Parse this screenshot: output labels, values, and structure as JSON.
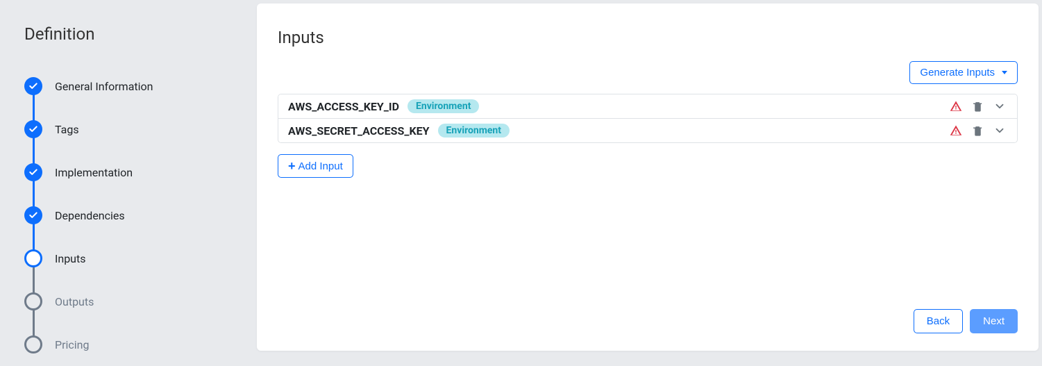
{
  "sidebar": {
    "title": "Definition",
    "steps": [
      {
        "label": "General Information",
        "state": "done"
      },
      {
        "label": "Tags",
        "state": "done"
      },
      {
        "label": "Implementation",
        "state": "done"
      },
      {
        "label": "Dependencies",
        "state": "done"
      },
      {
        "label": "Inputs",
        "state": "current"
      },
      {
        "label": "Outputs",
        "state": "pending"
      },
      {
        "label": "Pricing",
        "state": "pending"
      }
    ]
  },
  "main": {
    "title": "Inputs",
    "generate_button": "Generate Inputs",
    "inputs": [
      {
        "name": "AWS_ACCESS_KEY_ID",
        "badge": "Environment",
        "has_warning": true
      },
      {
        "name": "AWS_SECRET_ACCESS_KEY",
        "badge": "Environment",
        "has_warning": true
      }
    ],
    "add_button": "Add Input",
    "footer": {
      "back": "Back",
      "next": "Next"
    }
  }
}
